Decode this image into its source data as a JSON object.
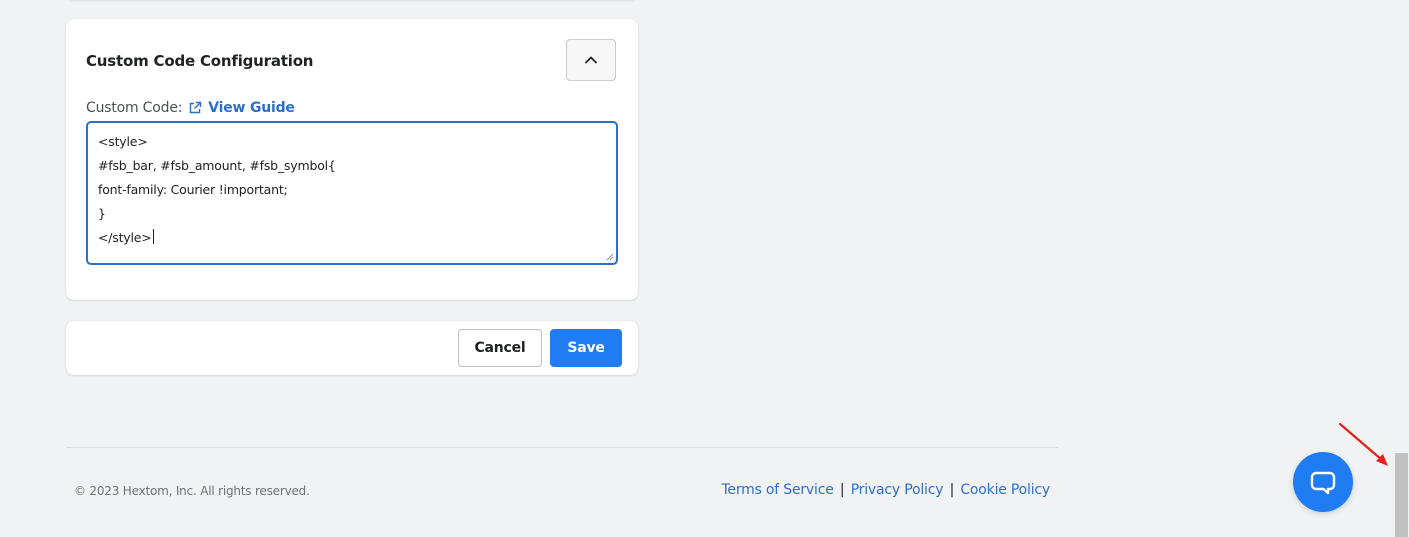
{
  "config_card": {
    "title": "Custom Code Configuration",
    "collapse_icon": "chevron-up-icon",
    "field_label": "Custom Code:",
    "guide_icon": "external-link-icon",
    "guide_link_label": "View Guide",
    "code_lines": [
      "<style>",
      "#fsb_bar, #fsb_amount, #fsb_symbol{",
      "font-family: Courier !important;",
      "}",
      "</style>"
    ]
  },
  "actions": {
    "cancel_label": "Cancel",
    "save_label": "Save"
  },
  "footer": {
    "copyright": "© 2023 Hextom, Inc. All rights reserved.",
    "links": [
      "Terms of Service",
      "Privacy Policy",
      "Cookie Policy"
    ],
    "separator": "|"
  },
  "chat": {
    "icon": "chat-bubble-icon"
  },
  "colors": {
    "accent": "#1f7cf2",
    "link": "#2c6ecb",
    "annotation_arrow": "#e8201b",
    "background": "#f1f2f4"
  }
}
